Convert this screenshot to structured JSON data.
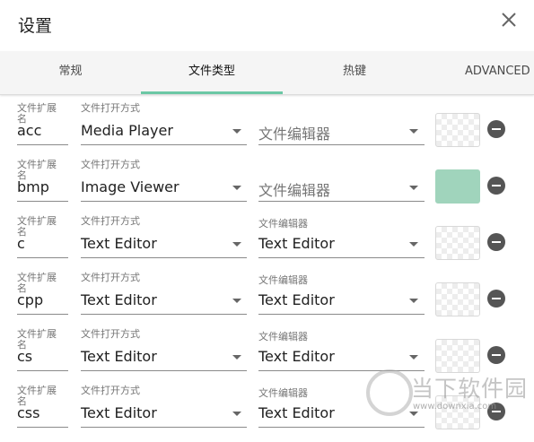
{
  "title": "设置",
  "icons": {
    "close": "close-icon",
    "remove": "minus-circle-icon",
    "caret": "caret-down-icon"
  },
  "tabs": [
    "常规",
    "文件类型",
    "热键",
    "ADVANCED"
  ],
  "field_labels": {
    "extension": "文件扩展名",
    "open_with": "文件打开方式",
    "editor": "文件编辑器"
  },
  "colors": {
    "accent": "#6cc8a5",
    "bmp_color": "#a0d4bc"
  },
  "rows": [
    {
      "ext": "acc",
      "open_with": "Media Player",
      "editor": "文件编辑器",
      "editor_label": ""
    },
    {
      "ext": "bmp",
      "open_with": "Image Viewer",
      "editor": "文件编辑器",
      "editor_label": ""
    },
    {
      "ext": "c",
      "open_with": "Text Editor",
      "editor": "Text Editor",
      "editor_label": "文件编辑器"
    },
    {
      "ext": "cpp",
      "open_with": "Text Editor",
      "editor": "Text Editor",
      "editor_label": "文件编辑器"
    },
    {
      "ext": "cs",
      "open_with": "Text Editor",
      "editor": "Text Editor",
      "editor_label": "文件编辑器"
    },
    {
      "ext": "css",
      "open_with": "Text Editor",
      "editor": "Text Editor",
      "editor_label": "文件编辑器"
    }
  ],
  "watermark": {
    "text": "当下软件园",
    "url": "www.downxia.com"
  }
}
